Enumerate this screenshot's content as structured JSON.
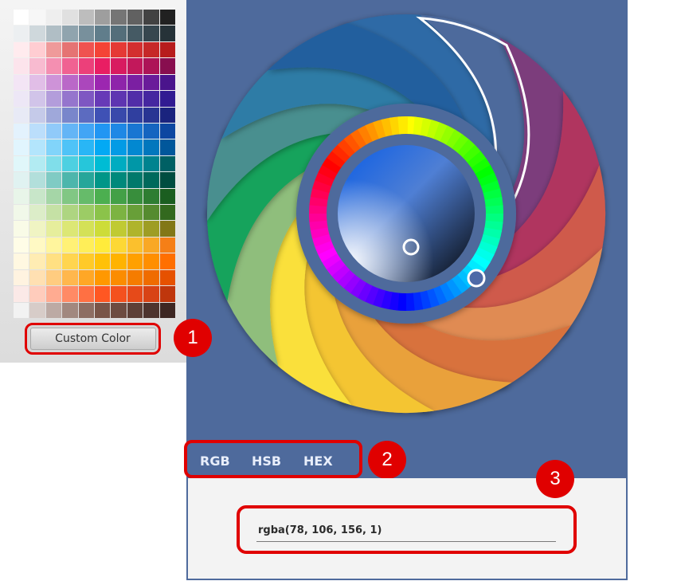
{
  "palette": {
    "custom_color_label": "Custom Color",
    "swatches": [
      [
        "#ffffff",
        "#f7f7f7",
        "#eeeeee",
        "#e0e0e0",
        "#bdbdbd",
        "#9e9e9e",
        "#757575",
        "#616161",
        "#424242",
        "#212121"
      ],
      [
        "#eceff1",
        "#cfd8dc",
        "#b0bec5",
        "#90a4ae",
        "#78909c",
        "#607d8b",
        "#546e7a",
        "#455a64",
        "#37474f",
        "#263238"
      ],
      [
        "#ffebee",
        "#ffcdd2",
        "#ef9a9a",
        "#e57373",
        "#ef5350",
        "#f44336",
        "#e53935",
        "#d32f2f",
        "#c62828",
        "#b71c1c"
      ],
      [
        "#fce4ec",
        "#f8bbd0",
        "#f48fb1",
        "#f06292",
        "#ec407a",
        "#e91e63",
        "#d81b60",
        "#c2185b",
        "#ad1457",
        "#880e4f"
      ],
      [
        "#f3e5f5",
        "#e1bee7",
        "#ce93d8",
        "#ba68c8",
        "#ab47bc",
        "#9c27b0",
        "#8e24aa",
        "#7b1fa2",
        "#6a1b9a",
        "#4a148c"
      ],
      [
        "#ede7f6",
        "#d1c4e9",
        "#b39ddb",
        "#9575cd",
        "#7e57c2",
        "#673ab7",
        "#5e35b1",
        "#512da8",
        "#4527a0",
        "#311b92"
      ],
      [
        "#e8eaf6",
        "#c5cae9",
        "#9fa8da",
        "#7986cb",
        "#5c6bc0",
        "#3f51b5",
        "#3949ab",
        "#303f9f",
        "#283593",
        "#1a237e"
      ],
      [
        "#e3f2fd",
        "#bbdefb",
        "#90caf9",
        "#64b5f6",
        "#42a5f5",
        "#2196f3",
        "#1e88e5",
        "#1976d2",
        "#1565c0",
        "#0d47a1"
      ],
      [
        "#e1f5fe",
        "#b3e5fc",
        "#81d4fa",
        "#4fc3f7",
        "#29b6f6",
        "#03a9f4",
        "#039be5",
        "#0288d1",
        "#0277bd",
        "#01579b"
      ],
      [
        "#e0f7fa",
        "#b2ebf2",
        "#80deea",
        "#4dd0e1",
        "#26c6da",
        "#00bcd4",
        "#00acc1",
        "#0097a7",
        "#00838f",
        "#006064"
      ],
      [
        "#e0f2f1",
        "#b2dfdb",
        "#80cbc4",
        "#4db6ac",
        "#26a69a",
        "#009688",
        "#00897b",
        "#00796b",
        "#00695c",
        "#004d40"
      ],
      [
        "#e8f5e9",
        "#c8e6c9",
        "#a5d6a7",
        "#81c784",
        "#66bb6a",
        "#4caf50",
        "#43a047",
        "#388e3c",
        "#2e7d32",
        "#1b5e20"
      ],
      [
        "#f1f8e9",
        "#dcedc8",
        "#c5e1a5",
        "#aed581",
        "#9ccc65",
        "#8bc34a",
        "#7cb342",
        "#689f38",
        "#558b2f",
        "#33691e"
      ],
      [
        "#f9fbe7",
        "#f0f4c3",
        "#e6ee9c",
        "#dce775",
        "#d4e157",
        "#cddc39",
        "#c0ca33",
        "#afb42b",
        "#9e9d24",
        "#827717"
      ],
      [
        "#fffde7",
        "#fff9c4",
        "#fff59d",
        "#fff176",
        "#ffee58",
        "#ffeb3b",
        "#fdd835",
        "#fbc02d",
        "#f9a825",
        "#f57f17"
      ],
      [
        "#fff8e1",
        "#ffecb3",
        "#ffe082",
        "#ffd54f",
        "#ffca28",
        "#ffc107",
        "#ffb300",
        "#ffa000",
        "#ff8f00",
        "#ff6f00"
      ],
      [
        "#fff3e0",
        "#ffe0b2",
        "#ffcc80",
        "#ffb74d",
        "#ffa726",
        "#ff9800",
        "#fb8c00",
        "#f57c00",
        "#ef6c00",
        "#e65100"
      ],
      [
        "#fbe9e7",
        "#ffccbc",
        "#ffab91",
        "#ff8a65",
        "#ff7043",
        "#ff5722",
        "#f4511e",
        "#e64a19",
        "#d84315",
        "#bf360c"
      ],
      [
        "#f2f2f2",
        "#d7ccc8",
        "#bcaaa4",
        "#a1887f",
        "#8d6e63",
        "#795548",
        "#6d4c41",
        "#5d4037",
        "#4e342e",
        "#3e2723"
      ]
    ]
  },
  "wheel": {
    "background": "#4e6a9c",
    "petal_colors": [
      "#2e6aa6",
      "#4e6a9c",
      "#7c3c7c",
      "#b0355f",
      "#cf5a4c",
      "#e08b52",
      "#d8723e",
      "#e9a13a",
      "#f4c531",
      "#fae03b",
      "#8fbe7c",
      "#13a35c",
      "#4a8f8f",
      "#2d7ca6",
      "#245f9e"
    ]
  },
  "modes": {
    "rgb": "RGB",
    "hsb": "HSB",
    "hex": "HEX"
  },
  "value": {
    "text": "rgba(78, 106, 156, 1)"
  },
  "callouts": {
    "one": "1",
    "two": "2",
    "three": "3"
  },
  "accent": "#e00000"
}
